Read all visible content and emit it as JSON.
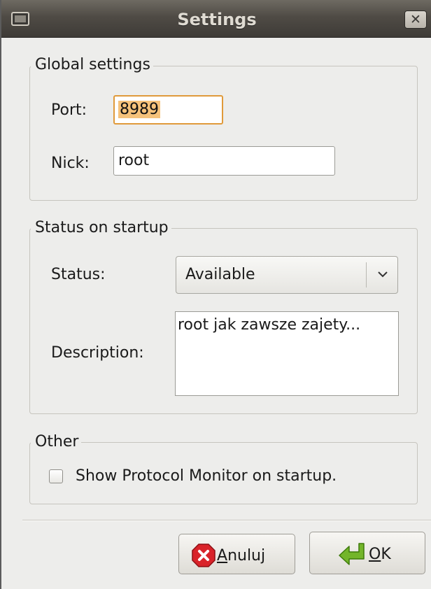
{
  "window": {
    "title": "Settings",
    "close_glyph": "✕"
  },
  "global": {
    "legend": "Global settings",
    "port_label": "Port:",
    "port_value": "8989",
    "nick_label": "Nick:",
    "nick_value": "root"
  },
  "startup": {
    "legend": "Status on startup",
    "status_label": "Status:",
    "status_value": "Available",
    "description_label": "Description:",
    "description_value": "root jak zawsze zajety..."
  },
  "other": {
    "legend": "Other",
    "protocol_monitor_label": "Show Protocol Monitor on startup.",
    "protocol_monitor_checked": false
  },
  "buttons": {
    "cancel": {
      "mnemonic": "A",
      "rest": "nuluj",
      "icon": "cancel-icon",
      "color": "#d9232a"
    },
    "ok": {
      "mnemonic": "O",
      "rest": "K",
      "icon": "enter-arrow-icon",
      "color": "#4e9a06"
    }
  }
}
